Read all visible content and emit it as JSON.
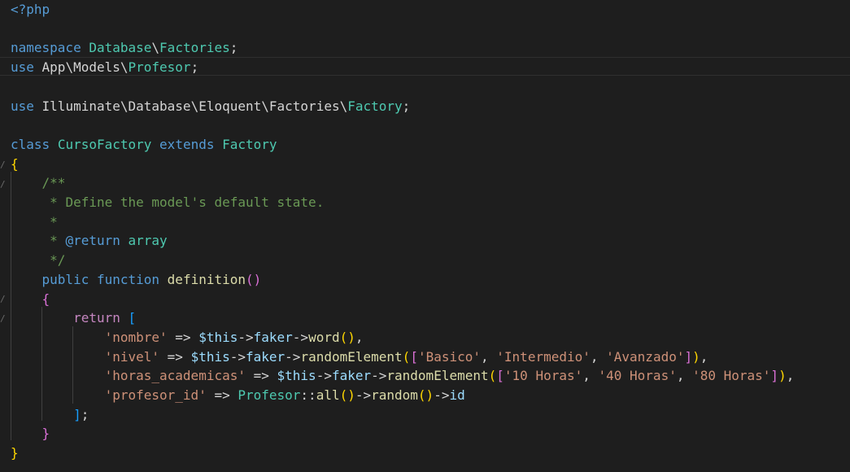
{
  "editor": {
    "language": "php",
    "colors": {
      "background": "#1e1e1e",
      "keyword": "#569cd6",
      "control": "#c586c0",
      "class": "#4ec9b0",
      "function": "#dcdcaa",
      "string": "#ce9178",
      "variable": "#9cdcfe",
      "comment": "#6a9955",
      "bracket_level1": "#ffd700",
      "bracket_level2": "#da70d6",
      "bracket_level3": "#179fff"
    },
    "lines": [
      {
        "tokens": [
          {
            "c": "kw",
            "t": "<?php"
          }
        ]
      },
      {
        "tokens": []
      },
      {
        "tokens": [
          {
            "c": "kw",
            "t": "namespace"
          },
          {
            "c": "pl",
            "t": " "
          },
          {
            "c": "cls",
            "t": "Database"
          },
          {
            "c": "pl",
            "t": "\\"
          },
          {
            "c": "cls",
            "t": "Factories"
          },
          {
            "c": "pl",
            "t": ";"
          }
        ]
      },
      {
        "tokens": [
          {
            "c": "kw",
            "t": "use"
          },
          {
            "c": "pl",
            "t": " App\\Models\\"
          },
          {
            "c": "cls",
            "t": "Profesor"
          },
          {
            "c": "pl",
            "t": ";"
          }
        ]
      },
      {
        "tokens": []
      },
      {
        "tokens": [
          {
            "c": "kw",
            "t": "use"
          },
          {
            "c": "pl",
            "t": " Illuminate\\Database\\Eloquent\\Factories\\"
          },
          {
            "c": "cls",
            "t": "Factory"
          },
          {
            "c": "pl",
            "t": ";"
          }
        ]
      },
      {
        "tokens": []
      },
      {
        "tokens": [
          {
            "c": "kw",
            "t": "class"
          },
          {
            "c": "pl",
            "t": " "
          },
          {
            "c": "cls",
            "t": "CursoFactory"
          },
          {
            "c": "pl",
            "t": " "
          },
          {
            "c": "kw",
            "t": "extends"
          },
          {
            "c": "pl",
            "t": " "
          },
          {
            "c": "cls",
            "t": "Factory"
          }
        ]
      },
      {
        "tokens": [
          {
            "c": "b1",
            "t": "{"
          }
        ]
      },
      {
        "tokens": [
          {
            "c": "pl",
            "t": "    "
          },
          {
            "c": "cm",
            "t": "/**"
          }
        ]
      },
      {
        "tokens": [
          {
            "c": "pl",
            "t": "     "
          },
          {
            "c": "cm",
            "t": "* Define the model's default state."
          }
        ]
      },
      {
        "tokens": [
          {
            "c": "pl",
            "t": "     "
          },
          {
            "c": "cm",
            "t": "*"
          }
        ]
      },
      {
        "tokens": [
          {
            "c": "pl",
            "t": "     "
          },
          {
            "c": "cm",
            "t": "* "
          },
          {
            "c": "kw",
            "t": "@return"
          },
          {
            "c": "pl",
            "t": " "
          },
          {
            "c": "cls",
            "t": "array"
          }
        ]
      },
      {
        "tokens": [
          {
            "c": "pl",
            "t": "     "
          },
          {
            "c": "cm",
            "t": "*/"
          }
        ]
      },
      {
        "tokens": [
          {
            "c": "pl",
            "t": "    "
          },
          {
            "c": "kw",
            "t": "public"
          },
          {
            "c": "pl",
            "t": " "
          },
          {
            "c": "kw",
            "t": "function"
          },
          {
            "c": "pl",
            "t": " "
          },
          {
            "c": "fn",
            "t": "definition"
          },
          {
            "c": "b2",
            "t": "()"
          }
        ]
      },
      {
        "tokens": [
          {
            "c": "pl",
            "t": "    "
          },
          {
            "c": "b2",
            "t": "{"
          }
        ]
      },
      {
        "tokens": [
          {
            "c": "pl",
            "t": "        "
          },
          {
            "c": "ctl",
            "t": "return"
          },
          {
            "c": "pl",
            "t": " "
          },
          {
            "c": "b3",
            "t": "["
          }
        ]
      },
      {
        "tokens": [
          {
            "c": "pl",
            "t": "            "
          },
          {
            "c": "str",
            "t": "'nombre'"
          },
          {
            "c": "pl",
            "t": " => "
          },
          {
            "c": "var",
            "t": "$this"
          },
          {
            "c": "pl",
            "t": "->"
          },
          {
            "c": "var",
            "t": "faker"
          },
          {
            "c": "pl",
            "t": "->"
          },
          {
            "c": "fn",
            "t": "word"
          },
          {
            "c": "b1",
            "t": "()"
          },
          {
            "c": "pl",
            "t": ","
          }
        ]
      },
      {
        "tokens": [
          {
            "c": "pl",
            "t": "            "
          },
          {
            "c": "str",
            "t": "'nivel'"
          },
          {
            "c": "pl",
            "t": " => "
          },
          {
            "c": "var",
            "t": "$this"
          },
          {
            "c": "pl",
            "t": "->"
          },
          {
            "c": "var",
            "t": "faker"
          },
          {
            "c": "pl",
            "t": "->"
          },
          {
            "c": "fn",
            "t": "randomElement"
          },
          {
            "c": "b1",
            "t": "("
          },
          {
            "c": "b2",
            "t": "["
          },
          {
            "c": "str",
            "t": "'Basico'"
          },
          {
            "c": "pl",
            "t": ", "
          },
          {
            "c": "str",
            "t": "'Intermedio'"
          },
          {
            "c": "pl",
            "t": ", "
          },
          {
            "c": "str",
            "t": "'Avanzado'"
          },
          {
            "c": "b2",
            "t": "]"
          },
          {
            "c": "b1",
            "t": ")"
          },
          {
            "c": "pl",
            "t": ","
          }
        ]
      },
      {
        "tokens": [
          {
            "c": "pl",
            "t": "            "
          },
          {
            "c": "str",
            "t": "'horas_academicas'"
          },
          {
            "c": "pl",
            "t": " => "
          },
          {
            "c": "var",
            "t": "$this"
          },
          {
            "c": "pl",
            "t": "->"
          },
          {
            "c": "var",
            "t": "faker"
          },
          {
            "c": "pl",
            "t": "->"
          },
          {
            "c": "fn",
            "t": "randomElement"
          },
          {
            "c": "b1",
            "t": "("
          },
          {
            "c": "b2",
            "t": "["
          },
          {
            "c": "str",
            "t": "'10 Horas'"
          },
          {
            "c": "pl",
            "t": ", "
          },
          {
            "c": "str",
            "t": "'40 Horas'"
          },
          {
            "c": "pl",
            "t": ", "
          },
          {
            "c": "str",
            "t": "'80 Horas'"
          },
          {
            "c": "b2",
            "t": "]"
          },
          {
            "c": "b1",
            "t": ")"
          },
          {
            "c": "pl",
            "t": ","
          }
        ]
      },
      {
        "tokens": [
          {
            "c": "pl",
            "t": "            "
          },
          {
            "c": "str",
            "t": "'profesor_id'"
          },
          {
            "c": "pl",
            "t": " => "
          },
          {
            "c": "cls",
            "t": "Profesor"
          },
          {
            "c": "pl",
            "t": "::"
          },
          {
            "c": "fn",
            "t": "all"
          },
          {
            "c": "b1",
            "t": "()"
          },
          {
            "c": "pl",
            "t": "->"
          },
          {
            "c": "fn",
            "t": "random"
          },
          {
            "c": "b1",
            "t": "()"
          },
          {
            "c": "pl",
            "t": "->"
          },
          {
            "c": "var",
            "t": "id"
          }
        ]
      },
      {
        "tokens": [
          {
            "c": "pl",
            "t": "        "
          },
          {
            "c": "b3",
            "t": "]"
          },
          {
            "c": "pl",
            "t": ";"
          }
        ]
      },
      {
        "tokens": [
          {
            "c": "pl",
            "t": "    "
          },
          {
            "c": "b2",
            "t": "}"
          }
        ]
      },
      {
        "tokens": [
          {
            "c": "b1",
            "t": "}"
          }
        ]
      }
    ]
  }
}
